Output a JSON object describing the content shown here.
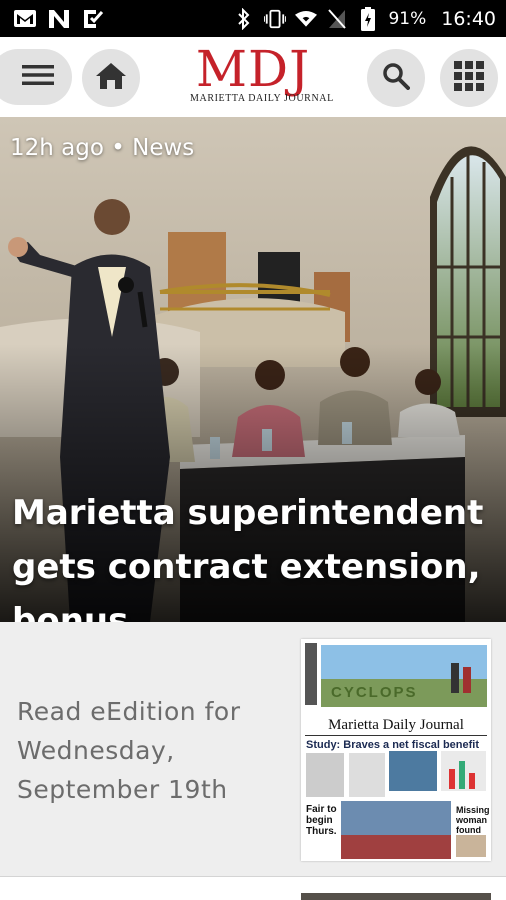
{
  "status_bar": {
    "icons_left": [
      "gmail-icon",
      "n-app-icon",
      "checklist-icon"
    ],
    "icons_right": [
      "bluetooth-icon",
      "vibrate-icon",
      "wifi-icon",
      "no-sim-icon",
      "battery-charging-icon"
    ],
    "battery": "91%",
    "time": "16:40"
  },
  "app_bar": {
    "menu_icon": "hamburger-menu-icon",
    "home_icon": "home-icon",
    "logo_main": "MDJ",
    "logo_sub": "MARIETTA DAILY JOURNAL",
    "search_icon": "search-icon",
    "grid_icon": "grid-icon",
    "brand_color": "#c5222a"
  },
  "hero": {
    "meta": "12h ago • News",
    "title": "Marietta superintendent gets contract extension, bonus"
  },
  "eedition": {
    "label": "Read eEdition for Wednesday, September 19th",
    "paper": {
      "banner": "CYCLOPS",
      "masthead": "Marietta Daily Journal",
      "headline": "Study: Braves a net fiscal benefit",
      "side_left": "Fair to begin Thurs.",
      "side_right": "Missing woman found"
    }
  }
}
